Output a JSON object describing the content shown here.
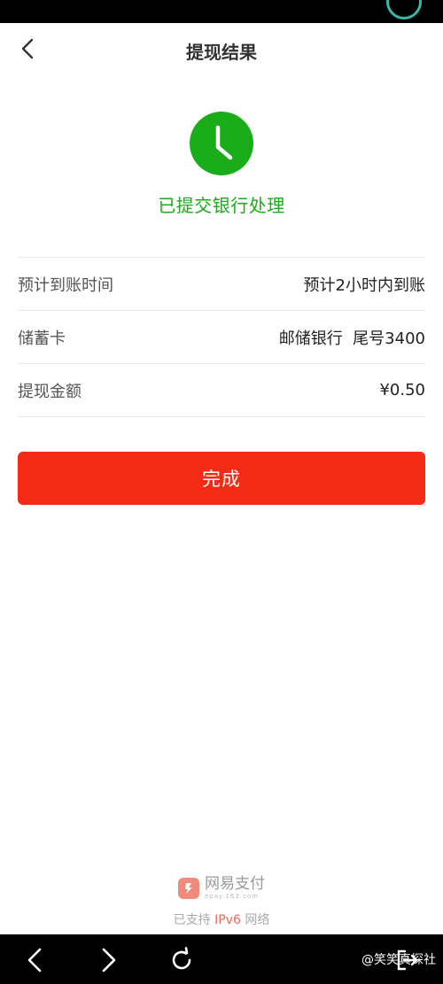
{
  "header": {
    "title": "提现结果"
  },
  "result": {
    "status_text": "已提交银行处理",
    "icon": "clock-icon",
    "color": "#1aad19"
  },
  "details": [
    {
      "label": "预计到账时间",
      "value": "预计2小时内到账"
    },
    {
      "label": "储蓄卡",
      "value": "邮储银行  尾号3400"
    },
    {
      "label": "提现金额",
      "value": "¥0.50"
    }
  ],
  "actions": {
    "done_label": "完成",
    "color": "#f52b16"
  },
  "footer": {
    "brand_name": "网易支付",
    "brand_domain": "epay.163.com",
    "ipv6_prefix": "已支持",
    "ipv6_highlight": "IPv6",
    "ipv6_suffix": "网络"
  },
  "watermark": "@笑笑真探社"
}
